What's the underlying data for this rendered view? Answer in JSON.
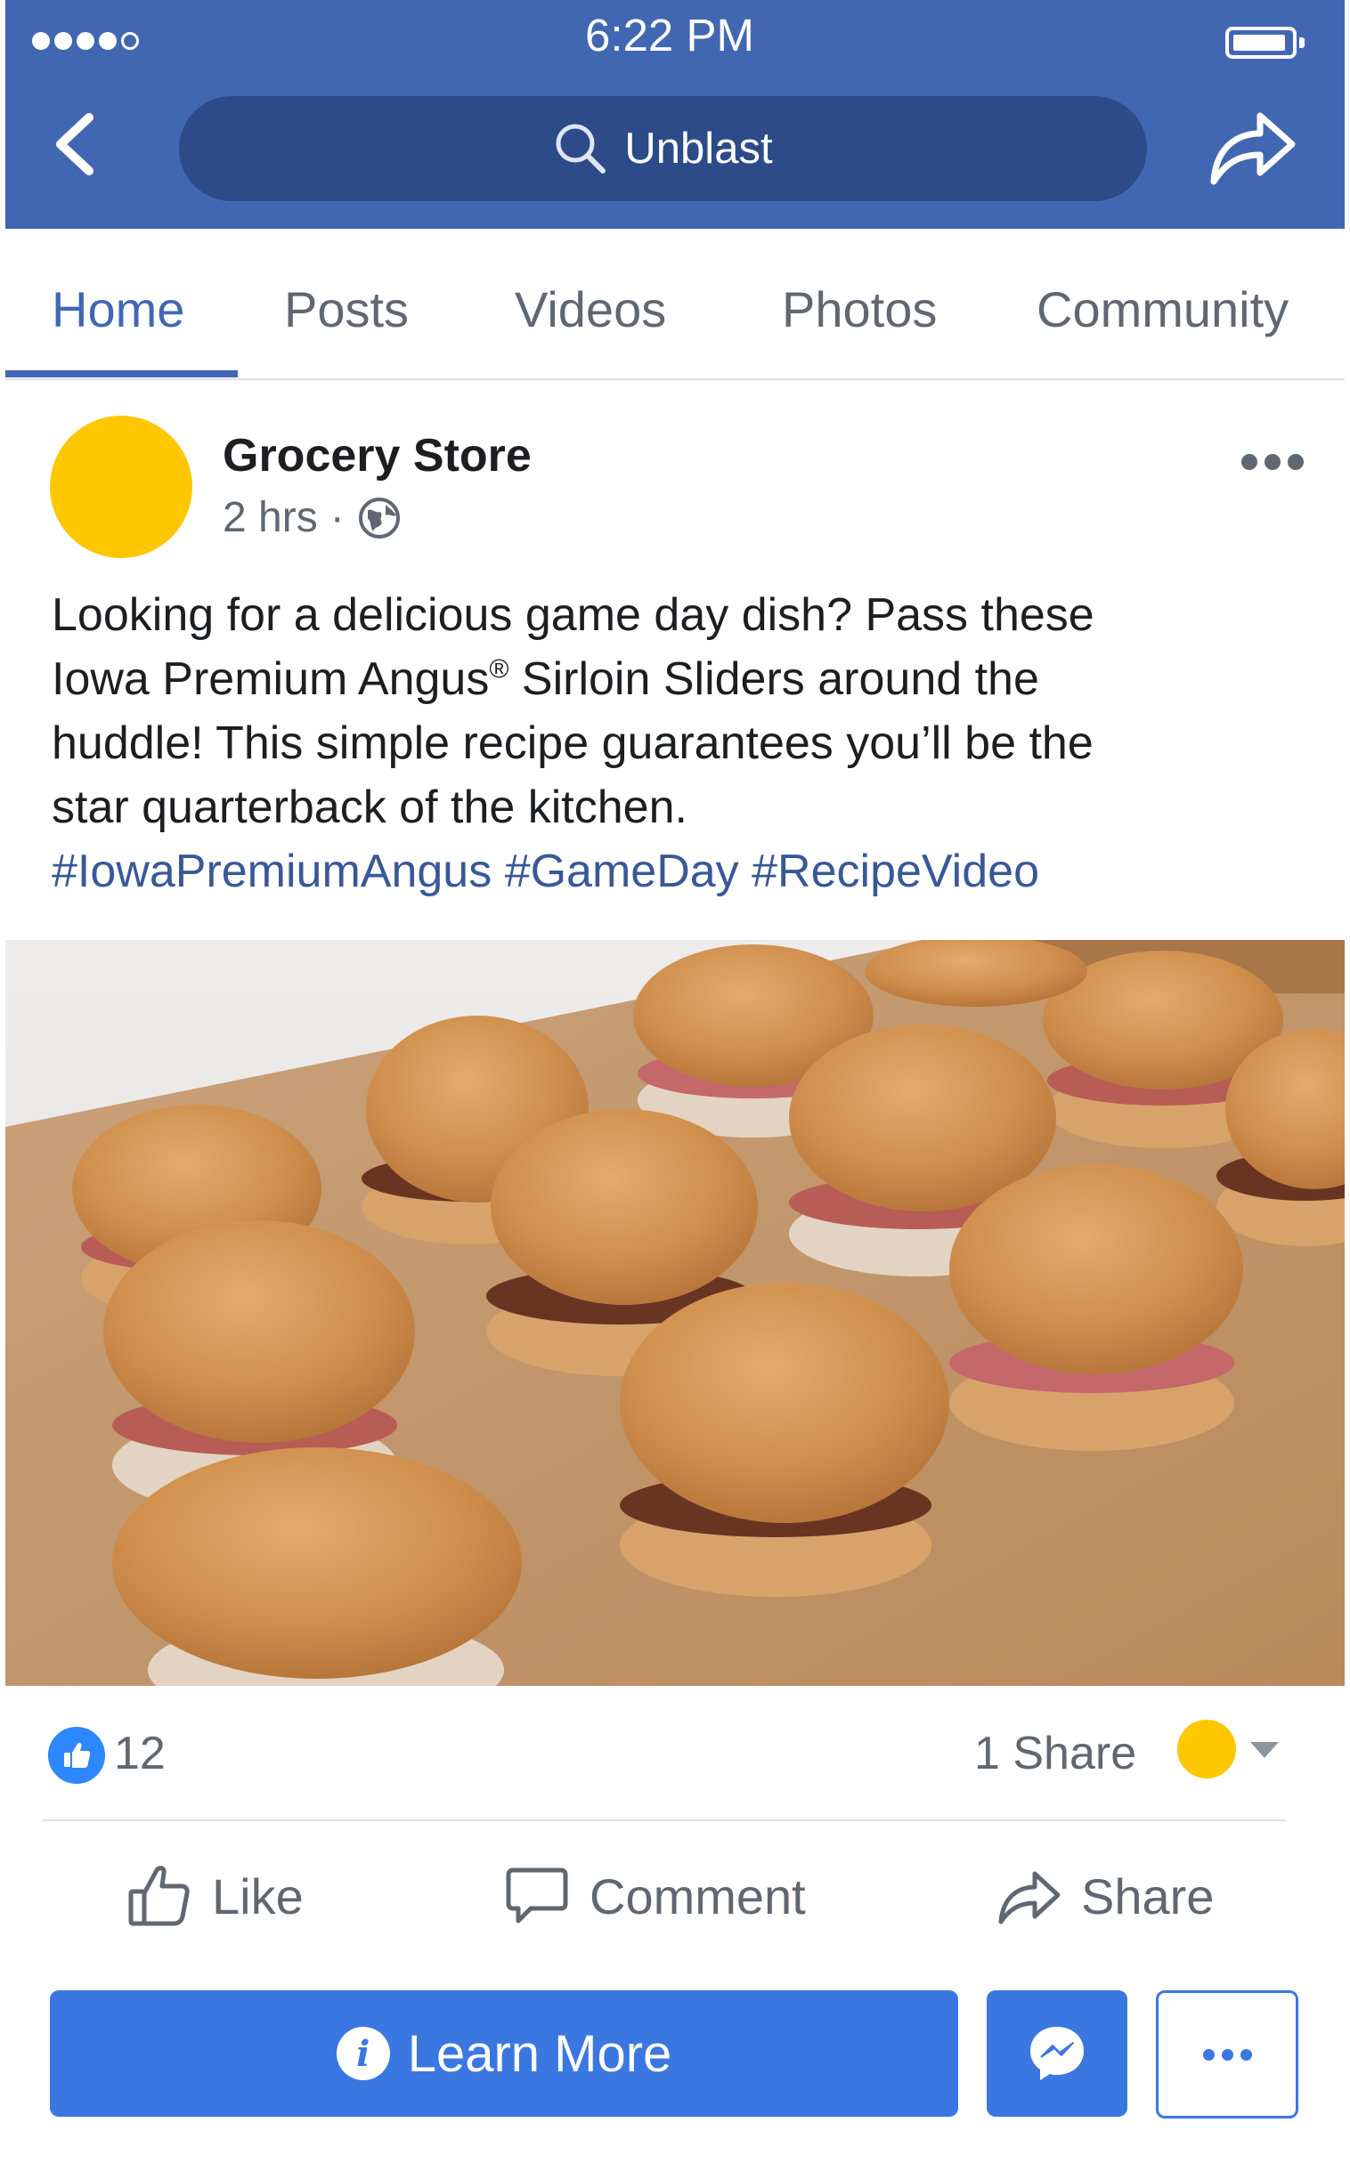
{
  "status_bar": {
    "time": "6:22 PM"
  },
  "header": {
    "search_text": "Unblast"
  },
  "tabs": [
    {
      "label": "Home",
      "active": true
    },
    {
      "label": "Posts"
    },
    {
      "label": "Videos"
    },
    {
      "label": "Photos"
    },
    {
      "label": "Community"
    }
  ],
  "post": {
    "author": "Grocery Store",
    "time": "2 hrs",
    "separator": "·",
    "privacy_icon": "globe-icon",
    "text_line1": "Looking for a delicious game day dish? Pass these",
    "text_line2_a": "Iowa Premium Angus",
    "text_line2_reg": "®",
    "text_line2_b": " Sirloin Sliders around the",
    "text_line3": "huddle! This simple recipe guarantees you’ll be the",
    "text_line4": "star quarterback of the kitchen.",
    "hashtags": [
      "#IowaPremiumAngus",
      "#GameDay",
      "#RecipeVideo"
    ],
    "image_alt": "Sirloin sliders on a wooden serving board"
  },
  "stats": {
    "likes": "12",
    "shares": "1 Share"
  },
  "actions": {
    "like": "Like",
    "comment": "Comment",
    "share": "Share"
  },
  "cta": {
    "label": "Learn More"
  },
  "colors": {
    "brand": "#4267b2",
    "brand_dark": "#2c4b88",
    "cta": "#3b77e0",
    "avatar": "#ffc700",
    "link": "#385898"
  }
}
